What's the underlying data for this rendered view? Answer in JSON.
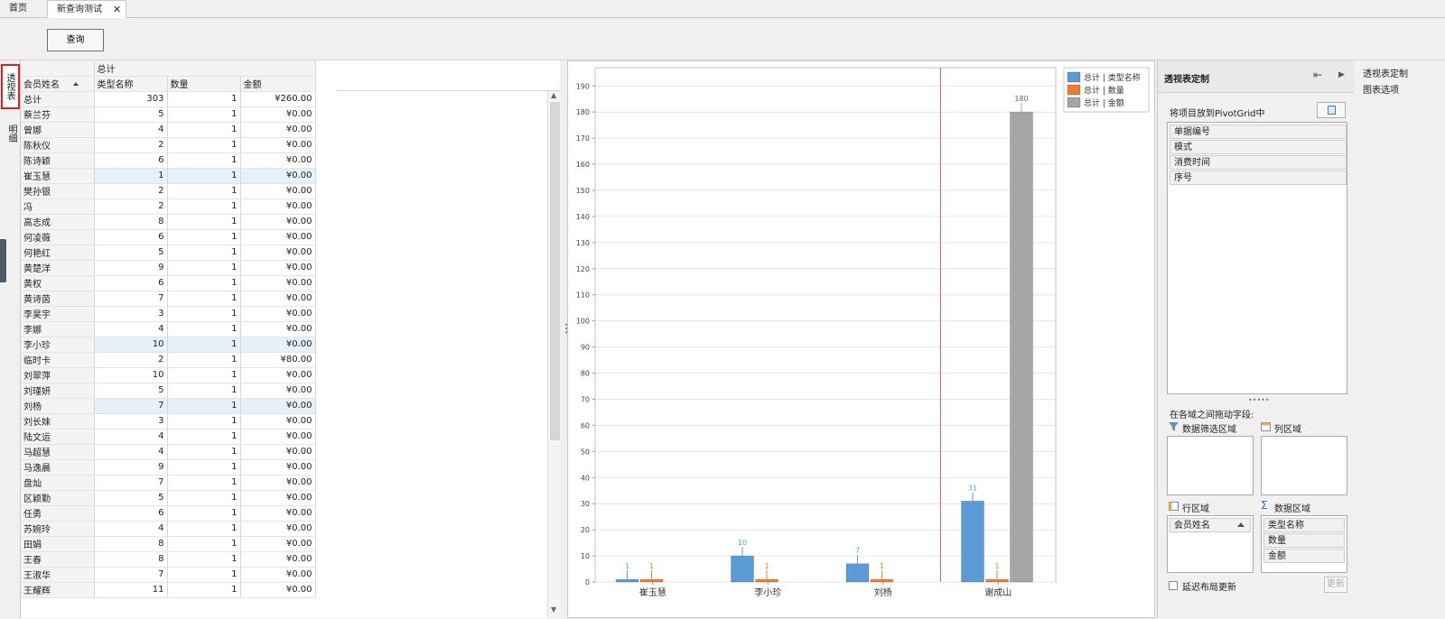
{
  "tabs": {
    "home": "首页",
    "active": "新查询测试",
    "close": "✕"
  },
  "toolbar": {
    "query_label": "查询"
  },
  "vtabs": {
    "pivot": "透视表",
    "detail": "明细"
  },
  "grid": {
    "top_header": "总计",
    "row_field": "会员姓名",
    "col_type": "类型名称",
    "col_qty": "数量",
    "col_amount": "金额",
    "rows": [
      {
        "name": "总计",
        "type": "303",
        "qty": "1",
        "amount": "¥260.00"
      },
      {
        "name": "蔡兰芬",
        "type": "5",
        "qty": "1",
        "amount": "¥0.00"
      },
      {
        "name": "曾娜",
        "type": "4",
        "qty": "1",
        "amount": "¥0.00"
      },
      {
        "name": "陈秋仪",
        "type": "2",
        "qty": "1",
        "amount": "¥0.00"
      },
      {
        "name": "陈诗颖",
        "type": "6",
        "qty": "1",
        "amount": "¥0.00"
      },
      {
        "name": "崔玉慧",
        "type": "1",
        "qty": "1",
        "amount": "¥0.00",
        "hl": true
      },
      {
        "name": "樊孙银",
        "type": "2",
        "qty": "1",
        "amount": "¥0.00"
      },
      {
        "name": "冯",
        "type": "2",
        "qty": "1",
        "amount": "¥0.00"
      },
      {
        "name": "高志成",
        "type": "8",
        "qty": "1",
        "amount": "¥0.00"
      },
      {
        "name": "何凌薇",
        "type": "6",
        "qty": "1",
        "amount": "¥0.00"
      },
      {
        "name": "何艳红",
        "type": "5",
        "qty": "1",
        "amount": "¥0.00"
      },
      {
        "name": "黄楚洋",
        "type": "9",
        "qty": "1",
        "amount": "¥0.00"
      },
      {
        "name": "黄权",
        "type": "6",
        "qty": "1",
        "amount": "¥0.00"
      },
      {
        "name": "黄诗茵",
        "type": "7",
        "qty": "1",
        "amount": "¥0.00"
      },
      {
        "name": "李昊宇",
        "type": "3",
        "qty": "1",
        "amount": "¥0.00"
      },
      {
        "name": "李娜",
        "type": "4",
        "qty": "1",
        "amount": "¥0.00"
      },
      {
        "name": "李小珍",
        "type": "10",
        "qty": "1",
        "amount": "¥0.00",
        "hl": true
      },
      {
        "name": "临时卡",
        "type": "2",
        "qty": "1",
        "amount": "¥80.00"
      },
      {
        "name": "刘翠萍",
        "type": "10",
        "qty": "1",
        "amount": "¥0.00"
      },
      {
        "name": "刘瑾妍",
        "type": "5",
        "qty": "1",
        "amount": "¥0.00"
      },
      {
        "name": "刘杨",
        "type": "7",
        "qty": "1",
        "amount": "¥0.00",
        "hl": true
      },
      {
        "name": "刘长妹",
        "type": "3",
        "qty": "1",
        "amount": "¥0.00"
      },
      {
        "name": "陆文运",
        "type": "4",
        "qty": "1",
        "amount": "¥0.00"
      },
      {
        "name": "马超慧",
        "type": "4",
        "qty": "1",
        "amount": "¥0.00"
      },
      {
        "name": "马逸晨",
        "type": "9",
        "qty": "1",
        "amount": "¥0.00"
      },
      {
        "name": "盘灿",
        "type": "7",
        "qty": "1",
        "amount": "¥0.00"
      },
      {
        "name": "区颖勤",
        "type": "5",
        "qty": "1",
        "amount": "¥0.00"
      },
      {
        "name": "任勇",
        "type": "6",
        "qty": "1",
        "amount": "¥0.00"
      },
      {
        "name": "苏婉玲",
        "type": "4",
        "qty": "1",
        "amount": "¥0.00"
      },
      {
        "name": "田娟",
        "type": "8",
        "qty": "1",
        "amount": "¥0.00"
      },
      {
        "name": "王春",
        "type": "8",
        "qty": "1",
        "amount": "¥0.00"
      },
      {
        "name": "王淑华",
        "type": "7",
        "qty": "1",
        "amount": "¥0.00"
      },
      {
        "name": "王耀辉",
        "type": "11",
        "qty": "1",
        "amount": "¥0.00"
      }
    ]
  },
  "chart_data": {
    "type": "bar",
    "categories": [
      "崔玉慧",
      "李小珍",
      "刘杨",
      "谢成山"
    ],
    "series": [
      {
        "name": "总计 | 类型名称",
        "values": [
          1,
          10,
          7,
          31
        ],
        "color": "#5b9bd5"
      },
      {
        "name": "总计 | 数量",
        "values": [
          1,
          1,
          1,
          1
        ],
        "color": "#ed7d31"
      },
      {
        "name": "总计 | 金额",
        "values": [
          0,
          0,
          0,
          180
        ],
        "color": "#a5a5a5"
      }
    ],
    "ylim": [
      0,
      197
    ],
    "yticks": [
      0,
      10,
      20,
      30,
      40,
      50,
      60,
      70,
      80,
      90,
      100,
      110,
      120,
      130,
      140,
      150,
      160,
      170,
      180,
      190
    ],
    "data_labels": [
      "1",
      "1",
      "10",
      "1",
      "7",
      "1",
      "31",
      "1",
      "180"
    ],
    "grid": true,
    "legend": "top-right",
    "marker_color": "#d84fd8"
  },
  "panel": {
    "title": "透视表定制",
    "instruction": "将项目放到PivotGrid中",
    "fields": [
      "单据编号",
      "模式",
      "消费时间",
      "序号"
    ],
    "drag_instruction": "在各域之间拖动字段:",
    "filter_area": "数据筛选区域",
    "column_area": "列区域",
    "row_area": "行区域",
    "data_area": "数据区域",
    "row_fields": [
      "会员姓名"
    ],
    "data_fields": [
      "类型名称",
      "数量",
      "金额"
    ],
    "defer_label": "延迟布局更新",
    "update_label": "更新",
    "handle": "•••••"
  },
  "side_menu": {
    "items": [
      "透视表定制",
      "图表选项"
    ]
  }
}
